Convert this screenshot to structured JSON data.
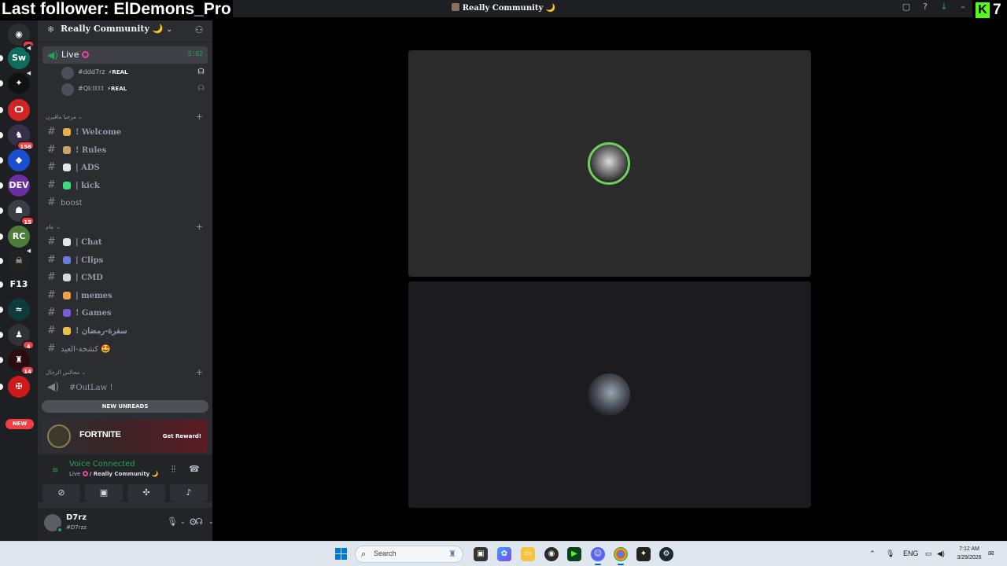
{
  "overlay": {
    "follower_text": "Last follower: ElDemons_Pro",
    "kick_logo": "K",
    "kick_count": "7"
  },
  "window": {
    "title": "Really Community 🌙",
    "icons": [
      "inbox-icon",
      "help-icon",
      "download-icon",
      "minimize-icon"
    ]
  },
  "servers": [
    {
      "name": "direct-messages",
      "glyph": "◉",
      "color": "#2b2d31",
      "badge": "1"
    },
    {
      "name": "sw",
      "glyph": "Sw",
      "color": "#0f6b5c",
      "speaker": true
    },
    {
      "name": "server-dark",
      "glyph": "✦",
      "color": "#111111",
      "speaker": true
    },
    {
      "name": "server-red",
      "glyph": "Ѻ",
      "color": "#d32424"
    },
    {
      "name": "server-156",
      "glyph": "♞",
      "color": "#3a2f4a",
      "badge": "156"
    },
    {
      "name": "server-blue",
      "glyph": "◆",
      "color": "#1b4fd1"
    },
    {
      "name": "server-dev",
      "glyph": "DEV",
      "color": "#6a2fa0"
    },
    {
      "name": "server-15",
      "glyph": "☗",
      "color": "#3b3d44",
      "badge": "15"
    },
    {
      "name": "server-green",
      "glyph": "RC",
      "color": "#4d7c3a"
    },
    {
      "name": "server-mono",
      "glyph": "☠",
      "color": "#222222",
      "speaker": true
    },
    {
      "name": "server-f13",
      "glyph": "F13",
      "color": "#1e1f22"
    },
    {
      "name": "server-teal",
      "glyph": "≈",
      "color": "#0d3b3b"
    },
    {
      "name": "server-4",
      "glyph": "♟",
      "color": "#303238",
      "badge": "4"
    },
    {
      "name": "server-14",
      "glyph": "♜",
      "color": "#2a0c10",
      "badge": "14"
    },
    {
      "name": "server-eagle",
      "glyph": "✠",
      "color": "#cc1a1a"
    }
  ],
  "rail_new_label": "NEW",
  "guild": {
    "name": "Really Community 🌙",
    "chevron": "⌄"
  },
  "voice_channel": {
    "name": "Live",
    "timer": "5:02",
    "users": [
      {
        "name": "#ddd7rz",
        "tag": "⚡REAL"
      },
      {
        "name": "#Q𝕜𝕥𝕥𝕥𝕥",
        "tag": "⚡REAL"
      }
    ]
  },
  "categories": [
    {
      "name": "مرحبا ماڤيرن ⌄"
    },
    {
      "name": "عام ⌄"
    },
    {
      "name": "مجالس الرجال ⌄"
    }
  ],
  "channels_welcome": [
    {
      "emoji_color": "#e8b04a",
      "name": "! Welcome"
    },
    {
      "emoji_color": "#c9a36a",
      "name": "! Rules"
    },
    {
      "emoji_color": "#e6e6e6",
      "name": "| ADS"
    },
    {
      "emoji_color": "#3ddc84",
      "name": "| kick"
    },
    {
      "name": "boost"
    }
  ],
  "channels_general": [
    {
      "emoji_color": "#e6e6e6",
      "name": "| Chat"
    },
    {
      "emoji_color": "#6c7bd9",
      "name": "| Clips"
    },
    {
      "emoji_color": "#d8d8d8",
      "name": "| CMD"
    },
    {
      "emoji_color": "#f0a04b",
      "name": "| memes"
    },
    {
      "emoji_color": "#7b5cd6",
      "name": "! Games"
    },
    {
      "emoji_color": "#e8c14a",
      "name": "! سفرة-رمضان"
    },
    {
      "name": "كشخة-العيد 🤩"
    }
  ],
  "channels_men": [
    {
      "name": "#OutLaw !"
    }
  ],
  "new_unreads": "NEW UNREADS",
  "promo": {
    "title": "FORTNITE",
    "cta": "Get Reward!"
  },
  "voice_status": {
    "title": "Voice Connected",
    "channel": "Live",
    "guild": "/ Really Community 🌙"
  },
  "user": {
    "name": "D7rz",
    "sub": "#D7rzz"
  },
  "taskbar": {
    "search_placeholder": "Search",
    "language": "ENG",
    "time": "7:12 AM",
    "date": "3/29/2026"
  },
  "colors": {
    "accent_green": "#23a559",
    "live_pink": "#eb459e",
    "kick_green": "#53fc18"
  }
}
